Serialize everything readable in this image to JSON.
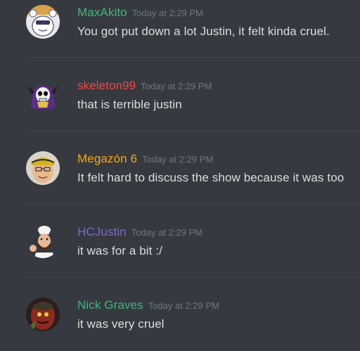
{
  "messages": [
    {
      "username": "MaxAkito",
      "username_color": "#43b581",
      "timestamp": "Today at 2:29 PM",
      "text": "You got put down a lot Justin, it felt kinda cruel.",
      "avatar_icon": "white-creature-avatar"
    },
    {
      "username": "skeleton99",
      "username_color": "#f04747",
      "timestamp": "Today at 2:29 PM",
      "text": "that is terrible justin",
      "avatar_icon": "skeleton-purple-hood-avatar"
    },
    {
      "username": "Megazón 6",
      "username_color": "#faa61a",
      "timestamp": "Today at 2:29 PM",
      "text": "It felt hard to discuss the show because it was too",
      "avatar_icon": "man-bandana-avatar"
    },
    {
      "username": "HCJustin",
      "username_color": "#7e6bc4",
      "timestamp": "Today at 2:29 PM",
      "text": "it was for a bit :/",
      "avatar_icon": "chef-avatar"
    },
    {
      "username": "Nick Graves",
      "username_color": "#43b581",
      "timestamp": "Today at 2:29 PM",
      "text": "it was very cruel",
      "avatar_icon": "red-creature-avatar"
    }
  ]
}
